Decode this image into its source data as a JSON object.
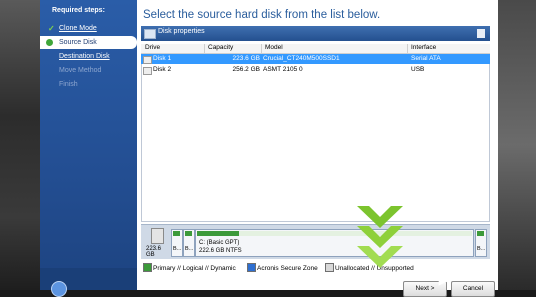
{
  "sidebar": {
    "title": "Required steps:",
    "items": [
      {
        "label": "Clone Mode",
        "state": "done"
      },
      {
        "label": "Source Disk",
        "state": "current"
      },
      {
        "label": "Destination Disk",
        "state": "link"
      },
      {
        "label": "Move Method",
        "state": "disabled"
      },
      {
        "label": "Finish",
        "state": "disabled"
      }
    ]
  },
  "main": {
    "heading": "Select the source hard disk from the list below.",
    "panel_title": "Disk properties",
    "columns": [
      "Drive",
      "Capacity",
      "Model",
      "Interface"
    ],
    "rows": [
      {
        "drive": "Disk 1",
        "capacity": "223.6 GB",
        "model": "Crucial_CT240M500SSD1",
        "interface": "Serial ATA",
        "selected": true
      },
      {
        "drive": "Disk 2",
        "capacity": "256.2 GB",
        "model": "ASMT 2105 0",
        "interface": "USB",
        "selected": false
      }
    ]
  },
  "disk_map": {
    "capacity": "223.6 GB",
    "small_label_1": "B...",
    "small_label_2": "B...",
    "partition_name": "C: (Basic GPT)",
    "partition_detail": "222.6 GB  NTFS",
    "right_label": "B..."
  },
  "legend": {
    "primary": "Primary // Logical // Dynamic",
    "acronis": "Acronis Secure Zone",
    "unallocated": "Unallocated // Unsupported"
  },
  "buttons": {
    "next": "Next >",
    "cancel": "Cancel"
  },
  "colors": {
    "sidebar": "#234e92",
    "selection": "#3399ff",
    "heading": "#2a5d9c",
    "chevron": "#7cc42e"
  }
}
